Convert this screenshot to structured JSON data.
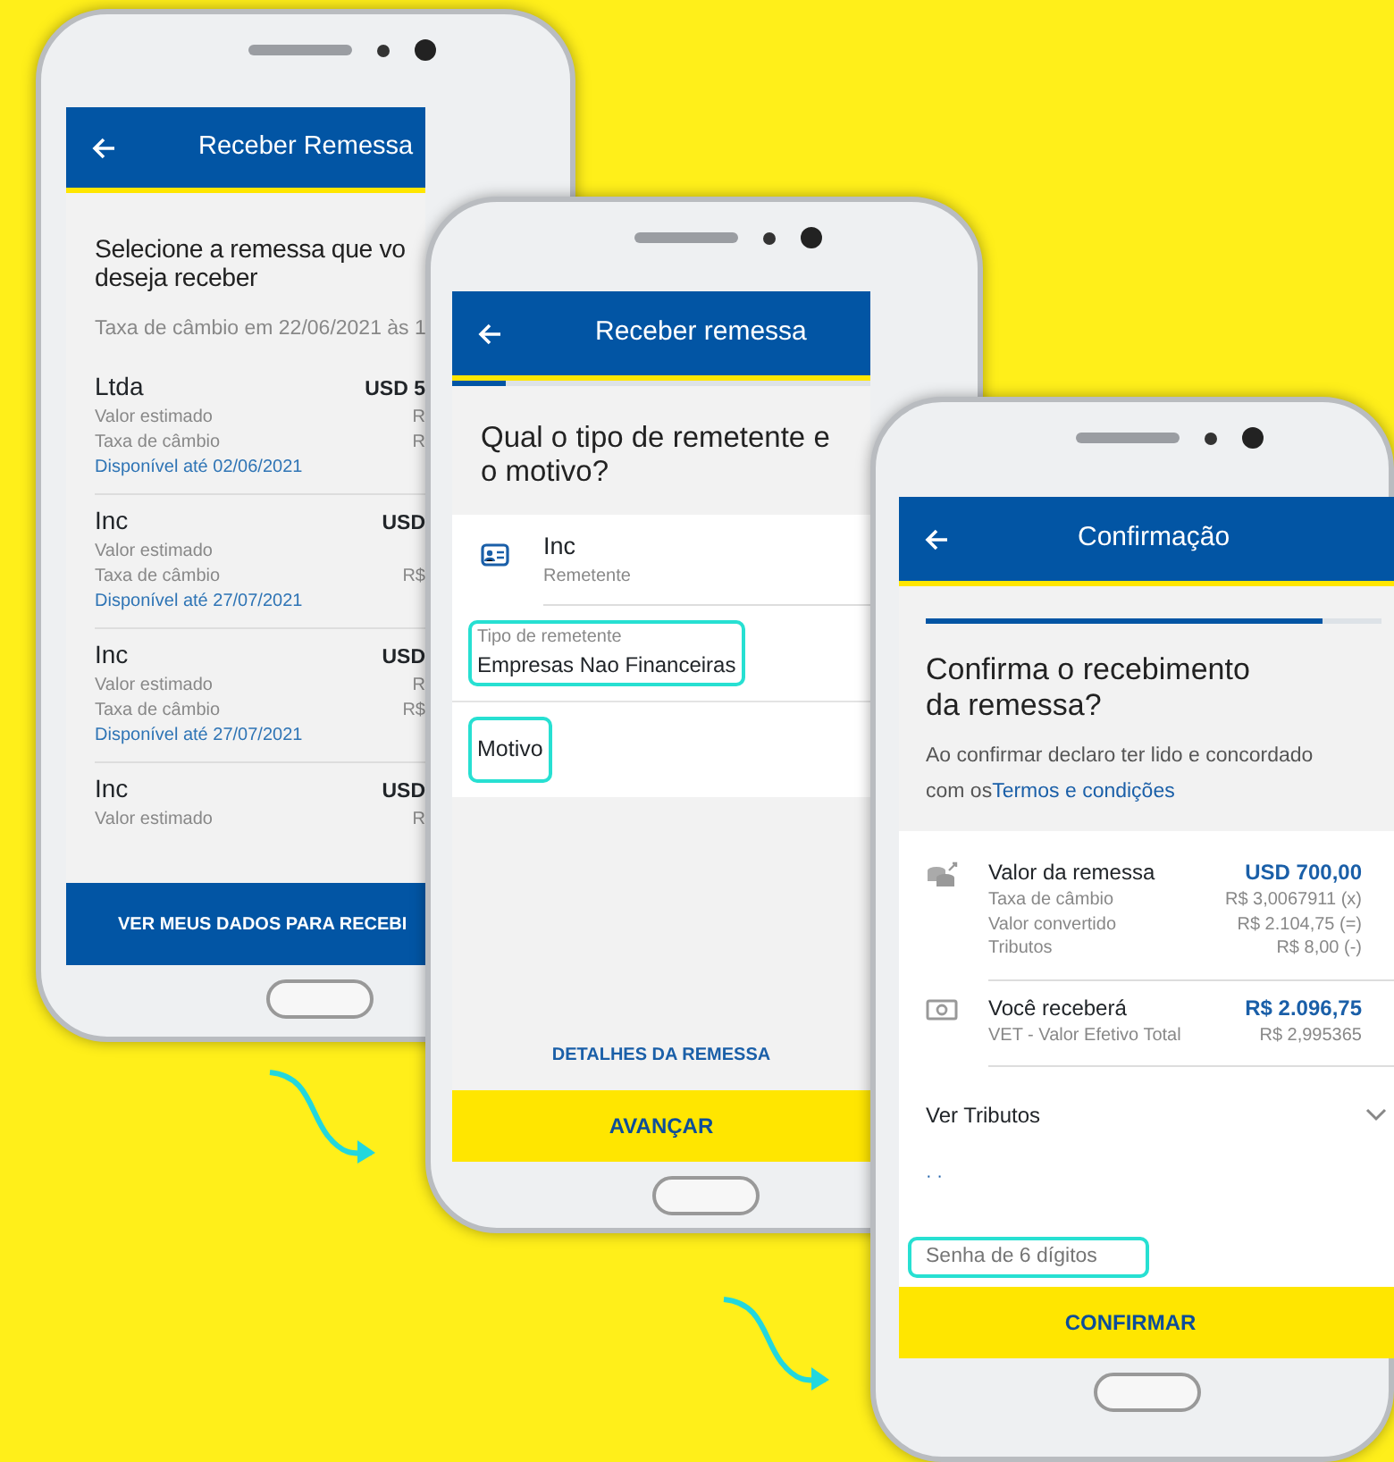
{
  "screens": [
    {
      "kind": "list",
      "title": "Receber Remessa",
      "heading_lines": [
        "Selecione a remessa que vo",
        "deseja receber"
      ],
      "rate_note": "Taxa de câmbio em 22/06/2021 às 1",
      "items": [
        {
          "name": "Ltda",
          "amount": "USD 5",
          "estimated_label": "Valor estimado",
          "estimated_value": "R",
          "rate_label": "Taxa de câmbio",
          "rate_value": "R",
          "availability": "Disponível até 02/06/2021"
        },
        {
          "name": "Inc",
          "amount": "USD",
          "estimated_label": "Valor estimado",
          "rate_label": "Taxa de câmbio",
          "rate_value": "R$",
          "availability": "Disponível até 27/07/2021"
        },
        {
          "name": "Inc",
          "amount": "USD",
          "estimated_label": "Valor estimado",
          "estimated_value": "R",
          "rate_label": "Taxa de câmbio",
          "rate_value": "R$",
          "availability": "Disponível até 27/07/2021"
        },
        {
          "name": "Inc",
          "amount": "USD",
          "estimated_label": "Valor estimado",
          "estimated_value": "R"
        }
      ],
      "button": "VER MEUS DADOS PARA RECEBI"
    },
    {
      "kind": "form",
      "title": "Receber remessa",
      "progress": {
        "level": 0.13
      },
      "heading": "Qual o tipo de remetente e o motivo?",
      "sender": {
        "name": "Inc",
        "role": "Remetente"
      },
      "fields": [
        {
          "label": "Tipo de remetente",
          "value": "Empresas Nao Financeiras",
          "highlighted": true
        },
        {
          "label": "Motivo",
          "highlighted": true
        }
      ],
      "link": "DETALHES DA REMESSA",
      "button": "AVANÇAR"
    },
    {
      "kind": "confirm",
      "title": "Confirmação",
      "progress": {
        "level": 0.87
      },
      "heading": "Confirma o recebimento da remessa?",
      "terms": "Ao confirmar declaro ter lido e concordado com os",
      "terms_link": "Termos e condições",
      "summary": [
        {
          "kind": "sent",
          "title": "Valor da remessa",
          "amount": "USD 700,00",
          "lines": [
            {
              "label": "Taxa de câmbio",
              "value": "R$ 3,0067911 (x)"
            },
            {
              "label": "Valor convertido",
              "value": "R$ 2.104,75 (=)"
            },
            {
              "label": "Tributos",
              "value": "R$ 8,00 (-)"
            }
          ]
        },
        {
          "kind": "received",
          "title": "Você receberá",
          "amount": "R$ 2.096,75",
          "lines": [
            {
              "label": "VET - Valor Efetivo Total",
              "value": "R$ 2,995365"
            }
          ]
        }
      ],
      "expander": {
        "label": "Ver Tributos",
        "expanded": false
      },
      "masked": "· ·",
      "password": {
        "placeholder": "Senha de 6 dígitos",
        "highlighted": true
      },
      "button": "CONFIRMAR"
    }
  ]
}
